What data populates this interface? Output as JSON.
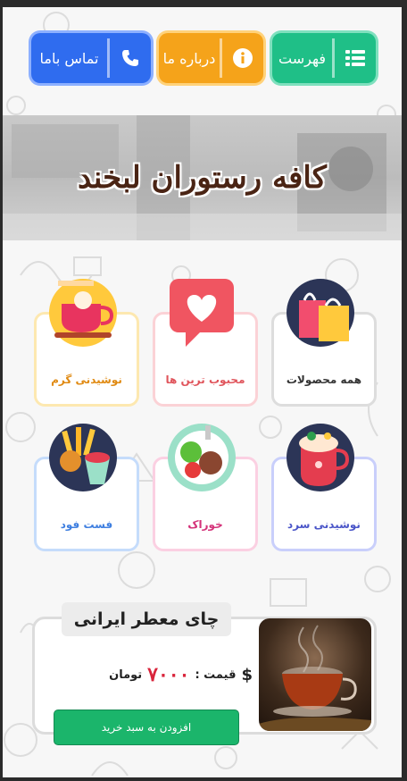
{
  "nav": {
    "menu_label": "فهرست",
    "about_label": "درباره ما",
    "contact_label": "تماس باما"
  },
  "hero": {
    "title": "کافه رستوران لبخند"
  },
  "categories": [
    {
      "label": "همه محصولات",
      "color": "#333333",
      "border": "#dddddd",
      "icon": "shopping-bags-icon"
    },
    {
      "label": "محبوب ترین ها",
      "color": "#e0555c",
      "border": "#fbd2d6",
      "icon": "heart-bubble-icon"
    },
    {
      "label": "نوشیدنی گرم",
      "color": "#e08a12",
      "border": "#fde8b0",
      "icon": "hot-drink-icon"
    },
    {
      "label": "نوشیدنی سرد",
      "color": "#4a55c8",
      "border": "#c9cffb",
      "icon": "cold-drink-icon"
    },
    {
      "label": "خوراک",
      "color": "#d4337a",
      "border": "#fbd0e2",
      "icon": "food-plate-icon"
    },
    {
      "label": "فست فود",
      "color": "#3f7fe0",
      "border": "#c5dcfb",
      "icon": "fast-food-icon"
    }
  ],
  "product": {
    "title": "چای معطر ایرانی",
    "price_label": "قیمت :",
    "price_value": "۷۰۰۰",
    "currency": "تومان",
    "add_label": "افزودن به سبد خرید",
    "image": "tea-cup-image"
  },
  "colors": {
    "menu": "#1fbf87",
    "about": "#f5a31a",
    "contact": "#2f6cef",
    "add_button": "#1bb56b",
    "price": "#d9243b"
  }
}
